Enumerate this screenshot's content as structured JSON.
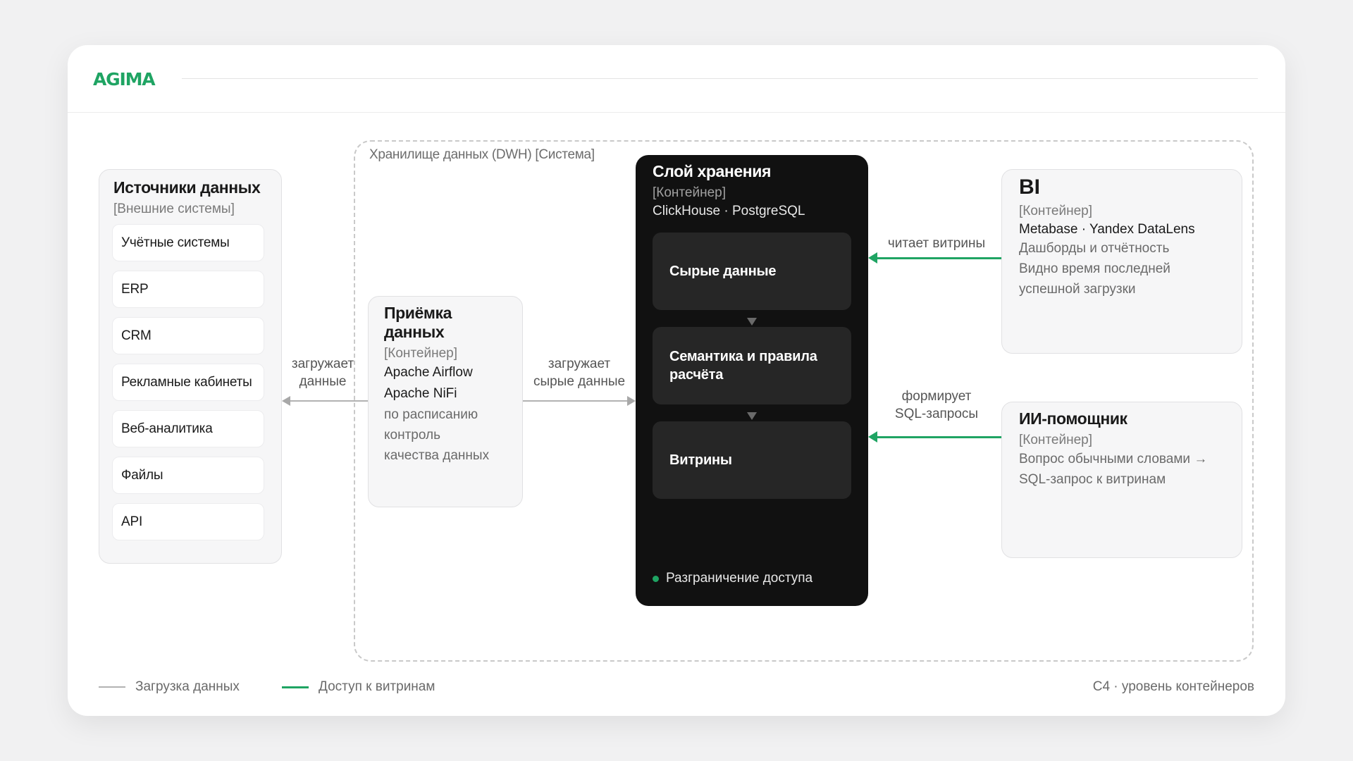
{
  "brand": {
    "logo": "AGIMA",
    "accent_color": "#1fa463"
  },
  "dwh": {
    "label": "Хранилище данных (DWH) [Система]"
  },
  "sources": {
    "title": "Источники данных",
    "subtitle": "[Внешние системы]",
    "items": [
      "Учётные системы",
      "ERP",
      "CRM",
      "Рекламные кабинеты",
      "Веб-аналитика",
      "Файлы",
      "API"
    ]
  },
  "intake": {
    "title": "Приёмка данных",
    "subtitle": "[Контейнер]",
    "tech": [
      "Apache Airflow",
      "Apache NiFi"
    ],
    "desc": [
      "по расписанию",
      "контроль",
      "качества данных"
    ]
  },
  "storage": {
    "title": "Слой хранения",
    "subtitle": "[Контейнер]",
    "tech": "ClickHouse · PostgreSQL",
    "layers": [
      "Сырые данные",
      "Семантика и правила расчёта",
      "Витрины"
    ],
    "access": "Разграничение доступа"
  },
  "bi": {
    "title": "BI",
    "subtitle": "[Контейнер]",
    "tech": "Metabase · Yandex DataLens",
    "desc": [
      "Дашборды и отчётность",
      "Видно время последней",
      "успешной загрузки"
    ]
  },
  "ai": {
    "title": "ИИ-помощник",
    "subtitle": "[Контейнер]",
    "desc": [
      "Вопрос обычными словами →",
      "SQL-запрос к витринам"
    ]
  },
  "connectors": {
    "sources_intake": [
      "загружает",
      "данные"
    ],
    "intake_storage": [
      "загружает",
      "сырые данные"
    ],
    "bi_storage": [
      "читает витрины"
    ],
    "ai_storage": [
      "формирует",
      "SQL-запросы"
    ]
  },
  "legend": {
    "load": "Загрузка данных",
    "access": "Доступ к витринам"
  },
  "footnote": "C4 · уровень контейнеров"
}
